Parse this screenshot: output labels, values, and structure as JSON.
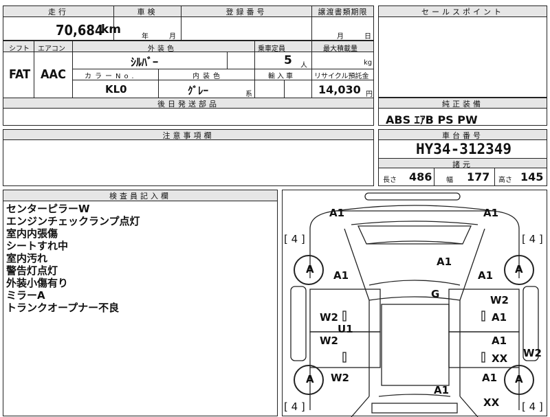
{
  "header": {
    "mileage_label": "走行",
    "mileage_value": "70,684",
    "mileage_unit": "km",
    "inspection_label": "車検",
    "inspection_year": "年",
    "inspection_month": "月",
    "reg_label": "登録番号",
    "transfer_label": "譲渡書類期限",
    "transfer_month": "月",
    "transfer_day": "日",
    "sales_point_label": "セールスポイント"
  },
  "specs": {
    "shift_label": "シフト",
    "shift_value": "FAT",
    "ac_label": "エアコン",
    "ac_value": "AAC",
    "color_label": "外装色",
    "color_value": "ｼﾙﾊﾞｰ",
    "capacity_label": "乗車定員",
    "capacity_value": "5",
    "capacity_unit": "人",
    "load_label": "最大積載量",
    "load_unit": "kg",
    "color_no_label": "カラーNo.",
    "color_no_value": "KL0",
    "interior_label": "内装色",
    "interior_value": "ｸﾞﾚｰ",
    "interior_suffix": "系",
    "import_label": "輸入車",
    "recycle_label": "リサイクル預託金",
    "recycle_value": "14,030",
    "recycle_unit": "円",
    "later_parts_label": "後日発送部品"
  },
  "equipment": {
    "label": "純正装備",
    "value": "ABS ｴｱB PS PW"
  },
  "notes_label": "注意事項欄",
  "chassis": {
    "label": "車台番号",
    "value": "HY34-312349"
  },
  "dimensions": {
    "label": "諸元",
    "length_label": "長さ",
    "length_value": "486",
    "width_label": "幅",
    "width_value": "177",
    "height_label": "高さ",
    "height_value": "145"
  },
  "inspector": {
    "label": "検査員記入欄",
    "lines": [
      "センターピラーW",
      "エンジンチェックランプ点灯",
      "室内内張傷",
      "シートすれ中",
      "室内汚れ",
      "警告灯点灯",
      "外装小傷有り",
      "ミラーA",
      "トランクオープナー不良"
    ]
  },
  "diagram": {
    "tires": [
      "[ 4 ]",
      "[ 4 ]",
      "[ 4 ]",
      "[ 4 ]"
    ],
    "wheel_marks": [
      "A",
      "A",
      "A",
      "A"
    ],
    "marks": {
      "front_left": "A1",
      "front_right": "A1",
      "hood": "A1",
      "fender_left": "A1",
      "fender_right": "A1",
      "roof": "G",
      "door_fl_w": "W2",
      "door_fr_w": "W2",
      "door_fr_a": "A1",
      "door_rl_w": "W2",
      "door_rr_a": "A1",
      "door_rr_xx": "XX",
      "pillar": "U1",
      "rocker_left": "W2",
      "rocker_right": "W2",
      "rear_fender_right": "A1",
      "trunk": "A1",
      "rear_bumper": "XX"
    }
  }
}
